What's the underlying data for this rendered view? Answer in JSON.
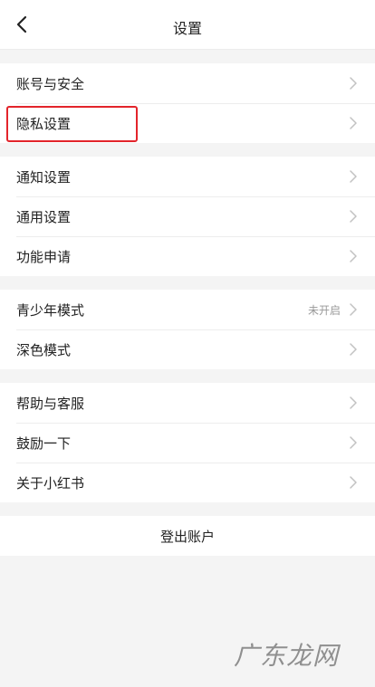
{
  "header": {
    "title": "设置",
    "back_icon": "chevron-left-icon"
  },
  "groups": [
    {
      "items": [
        {
          "label": "账号与安全",
          "value": ""
        },
        {
          "label": "隐私设置",
          "value": ""
        }
      ]
    },
    {
      "items": [
        {
          "label": "通知设置",
          "value": ""
        },
        {
          "label": "通用设置",
          "value": ""
        },
        {
          "label": "功能申请",
          "value": ""
        }
      ]
    },
    {
      "items": [
        {
          "label": "青少年模式",
          "value": "未开启"
        },
        {
          "label": "深色模式",
          "value": ""
        }
      ]
    },
    {
      "items": [
        {
          "label": "帮助与客服",
          "value": ""
        },
        {
          "label": "鼓励一下",
          "value": ""
        },
        {
          "label": "关于小红书",
          "value": ""
        }
      ]
    }
  ],
  "logout_label": "登出账户",
  "watermark": "广东龙网",
  "colors": {
    "highlight": "#e3242b",
    "background": "#f4f4f4",
    "chevron": "#c2c2c2"
  }
}
